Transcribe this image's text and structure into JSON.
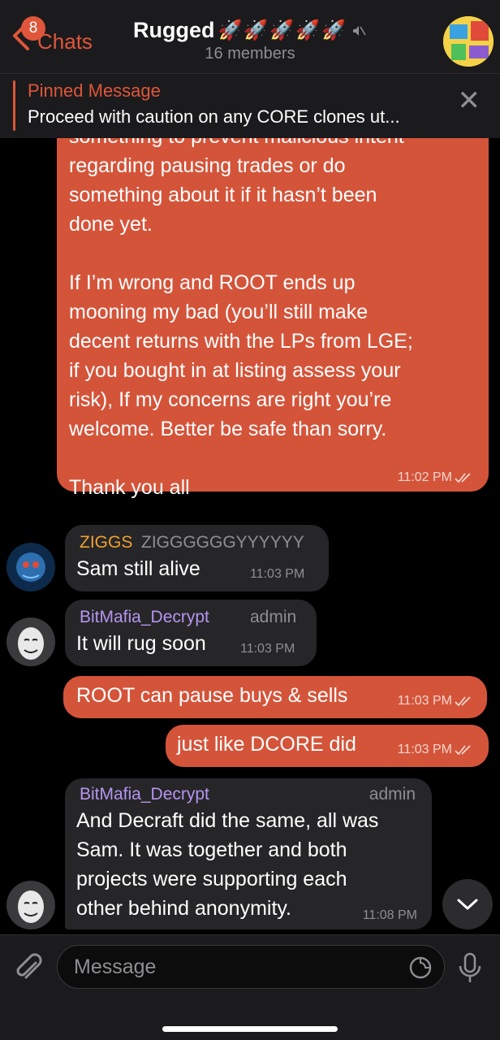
{
  "header": {
    "back_badge": "8",
    "back_label": "Chats",
    "title": "Rugged",
    "title_emoji": "🚀🚀🚀🚀🚀",
    "subtitle": "16 members"
  },
  "pinned": {
    "title": "Pinned Message",
    "text": "Proceed with caution on any CORE clones ut..."
  },
  "messages": {
    "m1": {
      "text": "something to prevent malicious intent\nregarding pausing trades or do\nsomething about it if it hasn’t been\ndone yet.\n\nIf I’m wrong and ROOT ends up\nmooning my bad (you’ll still make\ndecent returns with the LPs from LGE;\nif you bought in at listing assess your\nrisk), If my concerns are right you’re\nwelcome. Better be safe than sorry.\n\nThank you all",
      "time": "11:02 PM"
    },
    "m2": {
      "sender": "ZIGGS",
      "sender_extra": "ZIGGGGGGYYYYYY",
      "text": "Sam still alive",
      "time": "11:03 PM"
    },
    "m3": {
      "sender": "BitMafia_Decrypt",
      "role": "admin",
      "text": "It will rug soon",
      "time": "11:03 PM"
    },
    "m4": {
      "text": "ROOT can pause buys & sells",
      "time": "11:03 PM"
    },
    "m5": {
      "text": "just like DCORE did",
      "time": "11:03 PM"
    },
    "m6": {
      "sender": "BitMafia_Decrypt",
      "role": "admin",
      "lines": [
        "And Decraft did the same, all was",
        "Sam. It was together and both",
        "projects were supporting each",
        "other behind anonymity."
      ],
      "time": "11:08 PM"
    }
  },
  "input": {
    "placeholder": "Message"
  },
  "colors": {
    "accent": "#e0563a",
    "bubble_out": "#d4543a",
    "bubble_in": "#262628",
    "ziggs": "#f0a030",
    "bitmafia": "#b695f0"
  }
}
